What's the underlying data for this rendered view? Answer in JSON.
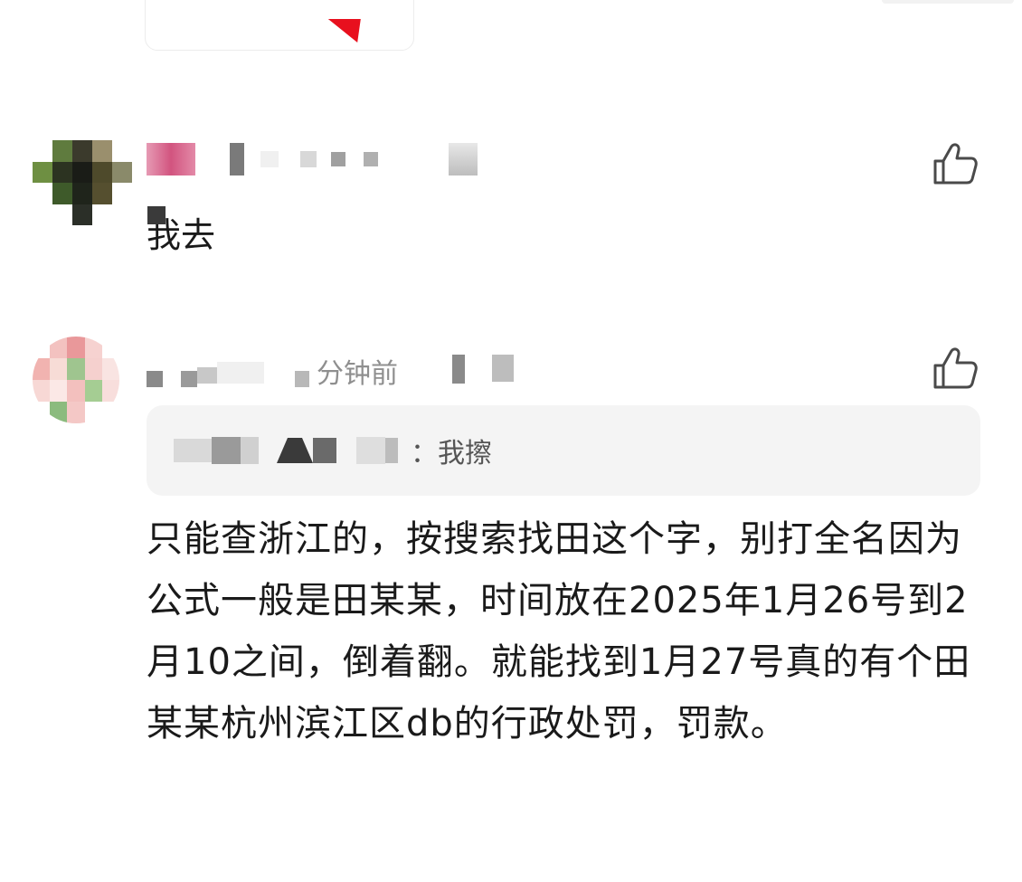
{
  "colors": {
    "accent_red": "#e8101e",
    "text_primary": "#1a1a1a",
    "text_secondary": "#8f8f8f",
    "quote_bg": "#f4f4f4"
  },
  "comments": [
    {
      "name": "",
      "time": "",
      "text": "我去",
      "like_icon": "thumbs-up-icon"
    },
    {
      "name": "",
      "time": "分钟前",
      "quote": {
        "author": "",
        "text": "：我擦"
      },
      "text": "只能查浙江的，按搜索找田这个字，别打全名因为公式一般是田某某，时间放在2025年1月26号到2月10之间，倒着翻。就能找到1月27号真的有个田某某杭州滨江区db的行政处罚，罚款。",
      "like_icon": "thumbs-up-icon"
    }
  ]
}
